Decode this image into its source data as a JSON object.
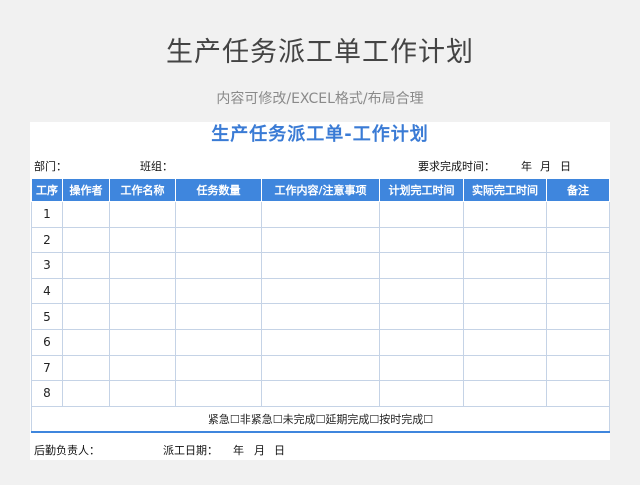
{
  "hero": {
    "title": "生产任务派工单工作计划",
    "subtitle": "内容可修改/EXCEL格式/布局合理"
  },
  "form": {
    "title": "生产任务派工单-工作计划",
    "department_label": "部门：",
    "team_label": "班组：",
    "required_time_label": "要求完成时间：",
    "year": "年",
    "month": "月",
    "day": "日"
  },
  "table": {
    "headers": [
      "工序",
      "操作者",
      "工作名称",
      "任务数量",
      "工作内容/注意事项",
      "计划完工时间",
      "实际完工时间",
      "备注"
    ],
    "rows": [
      "1",
      "2",
      "3",
      "4",
      "5",
      "6",
      "7",
      "8"
    ],
    "footer": "紧急☐非紧急☐未完成☐延期完成☐按时完成☐"
  },
  "signature": {
    "logistics_label": "后勤负责人：",
    "dispatch_date_label": "派工日期：",
    "year": "年",
    "month": "月",
    "day": "日"
  },
  "colors": {
    "accent": "#3f86dd",
    "title_blue": "#3a7bd5",
    "background": "#f1f1f1"
  }
}
